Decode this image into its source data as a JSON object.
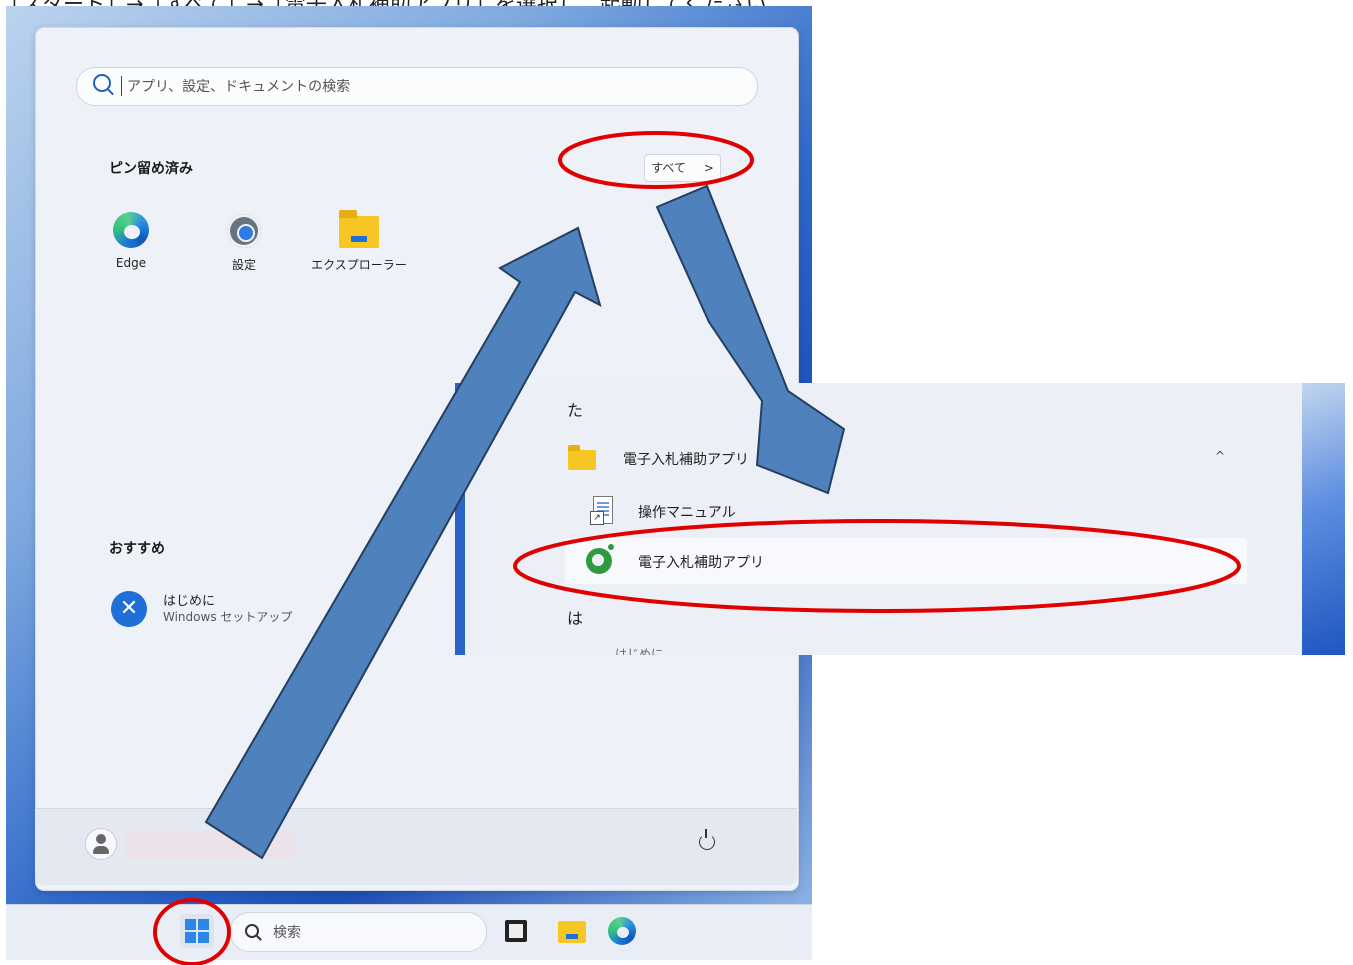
{
  "caption": "「スタート」→「すべて」→「電子入札補助アプリ」を選択し、起動してください。",
  "start_menu": {
    "search_placeholder": "アプリ、設定、ドキュメントの検索",
    "pinned_title": "ピン留め済み",
    "all_button_label": "すべて",
    "all_button_chevron": ">",
    "pinned_apps": [
      {
        "label": "Edge",
        "icon": "edge-icon"
      },
      {
        "label": "設定",
        "icon": "gear-icon"
      },
      {
        "label": "エクスプローラー",
        "icon": "folder-icon"
      }
    ],
    "recommended_title": "おすすめ",
    "recommended": [
      {
        "title": "はじめに",
        "subtitle": "Windows セットアップ",
        "icon": "get-started-icon"
      }
    ],
    "power_icon": "power-icon"
  },
  "taskbar": {
    "search_text": "検索"
  },
  "all_apps": {
    "section_ta": "た",
    "folder_label": "電子入札補助アプリ",
    "folder_chevron": "^",
    "items": [
      {
        "label": "操作マニュアル",
        "icon": "document-shortcut-icon"
      },
      {
        "label": "電子入札補助アプリ",
        "icon": "ebid-app-icon"
      }
    ],
    "section_ha": "は",
    "cutoff_item": "はじめに"
  },
  "colors": {
    "arrow_fill": "#4f81bd",
    "arrow_stroke": "#243f60",
    "highlight_ellipse": "#e00000"
  }
}
